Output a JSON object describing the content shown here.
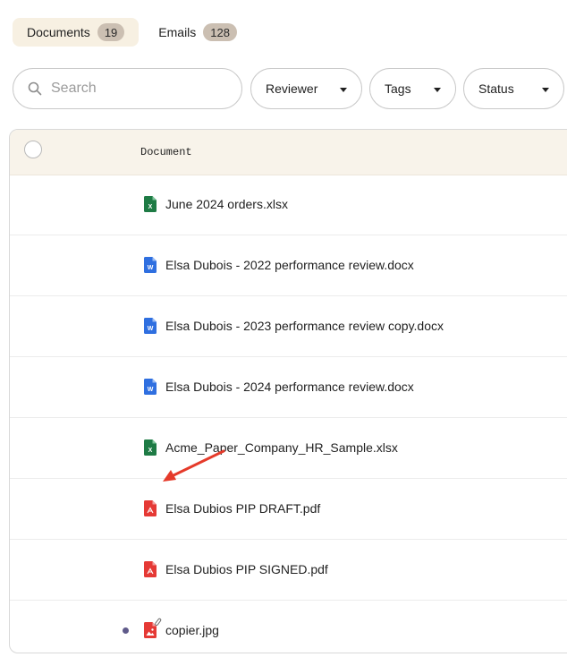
{
  "tabs": [
    {
      "label": "Documents",
      "count": "19"
    },
    {
      "label": "Emails",
      "count": "128"
    }
  ],
  "search": {
    "placeholder": "Search",
    "value": ""
  },
  "filters": {
    "reviewer": "Reviewer",
    "tags": "Tags",
    "status": "Status"
  },
  "table": {
    "column_document": "Document",
    "rows": [
      {
        "name": "June 2024 orders.xlsx",
        "type": "xlsx-icon"
      },
      {
        "name": "Elsa Dubois - 2022 performance review.docx",
        "type": "docx-icon"
      },
      {
        "name": "Elsa Dubois - 2023 performance review copy.docx",
        "type": "docx-icon"
      },
      {
        "name": "Elsa Dubois - 2024 performance review.docx",
        "type": "docx-icon"
      },
      {
        "name": "Acme_Paper_Company_HR_Sample.xlsx",
        "type": "xlsx-icon"
      },
      {
        "name": "Elsa Dubios PIP DRAFT.pdf",
        "type": "pdf-icon"
      },
      {
        "name": "Elsa Dubios PIP SIGNED.pdf",
        "type": "pdf-icon"
      },
      {
        "name": "copier.jpg",
        "type": "image-icon",
        "unread": true,
        "attachment": true
      }
    ]
  },
  "colors": {
    "tab_active_bg": "#f7f0e2",
    "badge_bg": "#cbbfb2",
    "header_bg": "#f8f3ea",
    "xlsx_green": "#1e7b45",
    "docx_blue": "#2f6fe0",
    "pdf_red": "#e53935",
    "annotation_arrow": "#e53a2a",
    "unread_dot": "#5f5a8a"
  }
}
